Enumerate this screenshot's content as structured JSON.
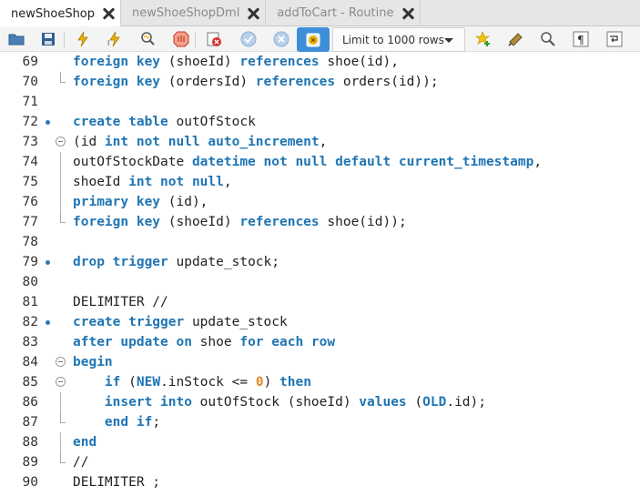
{
  "tabs": [
    {
      "label": "newShoeShop",
      "active": true
    },
    {
      "label": "newShoeShopDml",
      "active": false
    },
    {
      "label": "addToCart - Routine",
      "active": false
    }
  ],
  "toolbar": {
    "icons": [
      "open-folder-icon",
      "save-icon",
      "execute-icon",
      "execute-current-icon",
      "explain-icon",
      "stop-icon",
      "toggle-continue-on-error-icon",
      "commit-icon",
      "rollback-icon",
      "autocommit-toggle-icon",
      "add-snippet-icon",
      "beautify-icon",
      "find-icon",
      "invisible-chars-icon",
      "wrap-lines-icon"
    ],
    "limit_label": "Limit to 1000 rows"
  },
  "editor": {
    "lines": [
      {
        "num": "69",
        "tokens": [
          [
            "k",
            "foreign key"
          ],
          [
            "t",
            " (shoeId) "
          ],
          [
            "k",
            "references"
          ],
          [
            "t",
            " shoe(id),"
          ]
        ]
      },
      {
        "num": "70",
        "tokens": [
          [
            "k",
            "foreign key"
          ],
          [
            "t",
            " (ordersId) "
          ],
          [
            "k",
            "references"
          ],
          [
            "t",
            " orders(id));"
          ]
        ]
      },
      {
        "num": "71",
        "tokens": []
      },
      {
        "num": "72",
        "tokens": [
          [
            "k",
            "create table"
          ],
          [
            "t",
            " outOfStock"
          ]
        ]
      },
      {
        "num": "73",
        "tokens": [
          [
            "t",
            "(id "
          ],
          [
            "k",
            "int not null auto_increment"
          ],
          [
            "t",
            ","
          ]
        ]
      },
      {
        "num": "74",
        "tokens": [
          [
            "t",
            "outOfStockDate "
          ],
          [
            "k",
            "datetime not null default current_timestamp"
          ],
          [
            "t",
            ","
          ]
        ]
      },
      {
        "num": "75",
        "tokens": [
          [
            "t",
            "shoeId "
          ],
          [
            "k",
            "int not null"
          ],
          [
            "t",
            ","
          ]
        ]
      },
      {
        "num": "76",
        "tokens": [
          [
            "k",
            "primary key"
          ],
          [
            "t",
            " (id),"
          ]
        ]
      },
      {
        "num": "77",
        "tokens": [
          [
            "k",
            "foreign key"
          ],
          [
            "t",
            " (shoeId) "
          ],
          [
            "k",
            "references"
          ],
          [
            "t",
            " shoe(id));"
          ]
        ]
      },
      {
        "num": "78",
        "tokens": []
      },
      {
        "num": "79",
        "tokens": [
          [
            "k",
            "drop trigger"
          ],
          [
            "t",
            " update_stock;"
          ]
        ]
      },
      {
        "num": "80",
        "tokens": []
      },
      {
        "num": "81",
        "tokens": [
          [
            "t",
            "DELIMITER //"
          ]
        ]
      },
      {
        "num": "82",
        "tokens": [
          [
            "k",
            "create trigger"
          ],
          [
            "t",
            " update_stock"
          ]
        ]
      },
      {
        "num": "83",
        "tokens": [
          [
            "k",
            "after update on"
          ],
          [
            "t",
            " shoe "
          ],
          [
            "k",
            "for each row"
          ]
        ]
      },
      {
        "num": "84",
        "tokens": [
          [
            "k",
            "begin"
          ]
        ]
      },
      {
        "num": "85",
        "tokens": [
          [
            "t",
            "    "
          ],
          [
            "k",
            "if"
          ],
          [
            "t",
            " ("
          ],
          [
            "k",
            "NEW"
          ],
          [
            "t",
            ".inStock <= "
          ],
          [
            "n",
            "0"
          ],
          [
            "t",
            ") "
          ],
          [
            "k",
            "then"
          ]
        ]
      },
      {
        "num": "86",
        "tokens": [
          [
            "t",
            "    "
          ],
          [
            "k",
            "insert into"
          ],
          [
            "t",
            " outOfStock (shoeId) "
          ],
          [
            "k",
            "values"
          ],
          [
            "t",
            " ("
          ],
          [
            "k",
            "OLD"
          ],
          [
            "t",
            ".id);"
          ]
        ]
      },
      {
        "num": "87",
        "tokens": [
          [
            "t",
            "    "
          ],
          [
            "k",
            "end if"
          ],
          [
            "t",
            ";"
          ]
        ]
      },
      {
        "num": "88",
        "tokens": [
          [
            "k",
            "end"
          ]
        ]
      },
      {
        "num": "89",
        "tokens": [
          [
            "t",
            "//"
          ]
        ]
      },
      {
        "num": "90",
        "tokens": [
          [
            "t",
            "DELIMITER ;"
          ]
        ]
      }
    ]
  }
}
